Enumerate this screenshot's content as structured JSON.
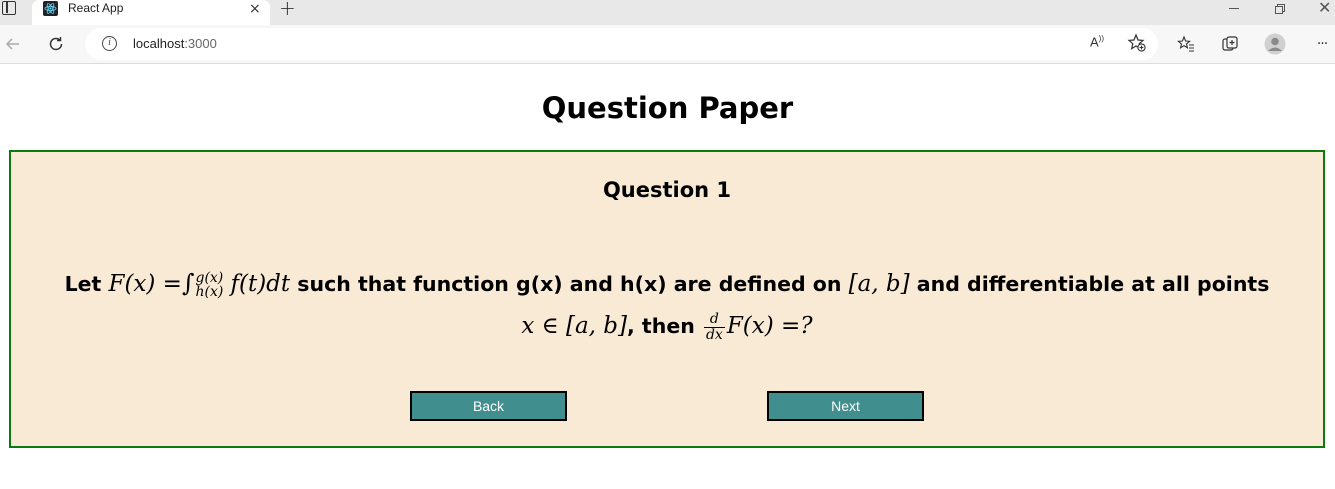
{
  "browser": {
    "tab": {
      "title": "React App",
      "favicon": "react-logo-icon",
      "close_icon": "×"
    },
    "new_tab_icon": "+",
    "address": {
      "host": "localhost",
      "port": ":3000"
    },
    "read_aloud_label": "A",
    "more_menu": "···"
  },
  "page": {
    "heading": "Question Paper"
  },
  "question": {
    "number_label": "Question 1",
    "text": {
      "let": "Let",
      "F_of_x": "F(x) =",
      "integral_upper": "g(x)",
      "integral_lower": "h(x)",
      "integrand": "f(t)dt",
      "mid": "such that function g(x) and h(x) are defined on",
      "interval_1": "[a, b]",
      "tail": "and differentiable at all points",
      "x_in": "x ∈ [a, b]",
      "then": ", then",
      "frac_num": "d",
      "frac_den": "dx",
      "end": "F(x) =?"
    }
  },
  "buttons": {
    "back": "Back",
    "next": "Next"
  },
  "colors": {
    "card_background": "#f9ead6",
    "card_border": "#0d7a0d",
    "button_background": "#418e8e"
  }
}
